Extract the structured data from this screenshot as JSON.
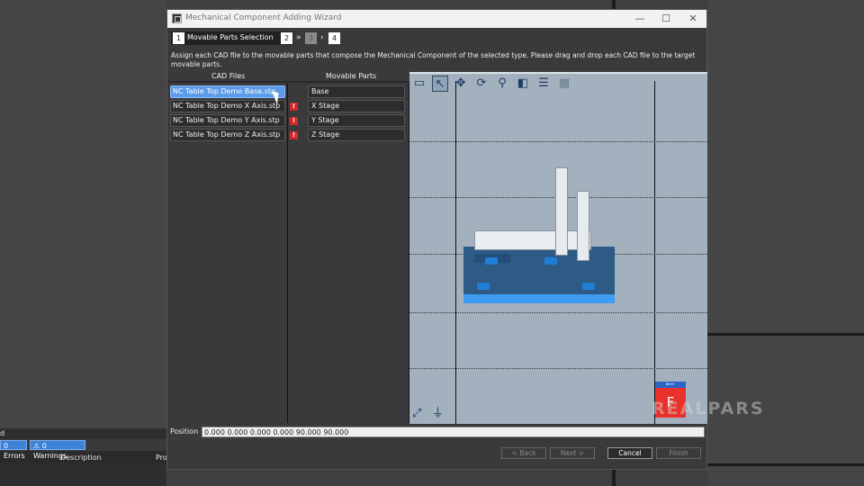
{
  "window": {
    "title": "Mechanical Component Adding Wizard",
    "minimize": "—",
    "maximize": "☐",
    "close": "✕"
  },
  "steps": [
    {
      "num": "1",
      "label": "Movable Parts Selection"
    },
    {
      "num": "2"
    },
    {
      "num": "3"
    },
    {
      "num": "4"
    }
  ],
  "instruction": "Assign each CAD file to the movable parts that compose the Mechanical Component of the selected type. Please drag and drop each CAD file to the target movable parts.",
  "columns": {
    "cad": "CAD Files",
    "movable": "Movable Parts"
  },
  "cad_files": [
    "NC Table Top Demo Base.stp",
    "NC Table Top Demo X Axis.stp",
    "NC Table Top Demo Y Axis.stp",
    "NC Table Top Demo Z Axis.stp"
  ],
  "warning_glyph": "!",
  "movable_parts": [
    "Base",
    "X Stage",
    "Y Stage",
    "Z Stage"
  ],
  "viewcube": {
    "face": "F",
    "arrow": "⟵"
  },
  "position": {
    "label": "Position",
    "value": "0.000 0.000 0.000 0.000 90.000 90.000"
  },
  "buttons": {
    "back": "< Back",
    "next": "Next >",
    "cancel": "Cancel",
    "finish": "Finish"
  },
  "background": {
    "errors": "0 Errors",
    "warnings": "0 Warnings",
    "description": "Description",
    "pro": "Pro",
    "d": "d"
  },
  "watermark": "REALPARS"
}
